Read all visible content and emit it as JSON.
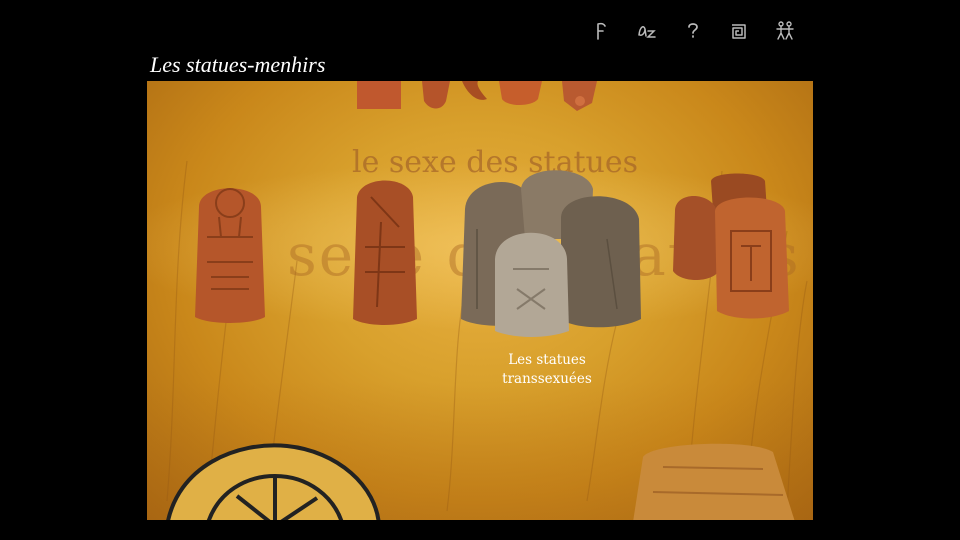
{
  "header": {
    "title": "Les statues-menhirs",
    "icons": [
      "f-glyph-icon",
      "az-glyph-icon",
      "question-glyph-icon",
      "spiral-glyph-icon",
      "figures-glyph-icon"
    ]
  },
  "stage": {
    "background_text": "le sexe des statues",
    "caption_line1": "Les statues",
    "caption_line2": "transsexuées"
  },
  "colors": {
    "background": "#000000",
    "stage": "#d8a02c",
    "stone": "#b5562a",
    "text": "#ffffff"
  }
}
